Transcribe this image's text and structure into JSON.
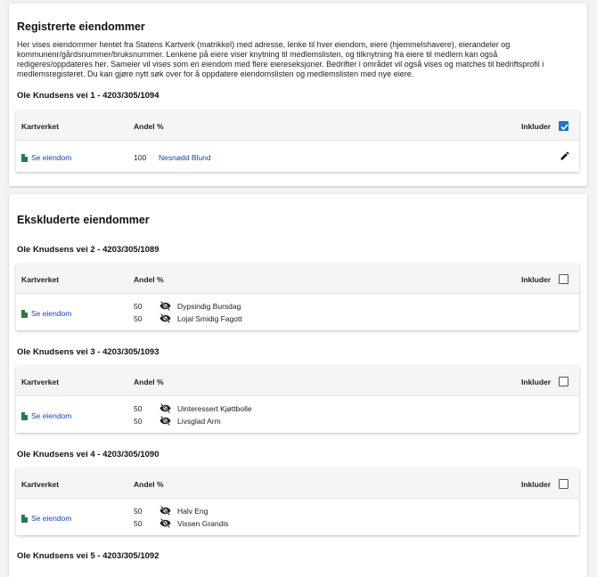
{
  "registered": {
    "title": "Registrerte eiendommer",
    "description": "Her vises eiendommer hentet fra Statens Kartverk (matrikkel) med adresse, lenke til hver eiendom, eiere (hjemmelshavere), eierandeler og kommunenr/gårdsnummer/bruksnummer. Lenkene på eiere viser knytning til medlemslisten, og tilknytning fra eiere til medlem kan også redigeres/oppdateres her. Sameier vil vises som en eiendom med flere eiereseksjoner. Bedrifter i området vil også vises og matches til bedriftsprofil i medlemsregisteret. Du kan gjøre nytt søk over for å oppdatere eiendomslisten og medlemslisten med nye eiere.",
    "properties": [
      {
        "address": "Ole Knudsens vei 1 - 4203/305/1094",
        "col_source": "Kartverket",
        "col_share": "Andel %",
        "col_include": "Inkluder",
        "included": true,
        "link_label": "Se eiendom",
        "owners": [
          {
            "share": "100",
            "name": "Nesnødd Blund"
          }
        ]
      }
    ]
  },
  "excluded": {
    "title": "Ekskluderte eiendommer",
    "properties": [
      {
        "address": "Ole Knudsens vei 2 - 4203/305/1089",
        "col_source": "Kartverket",
        "col_share": "Andel %",
        "col_include": "Inkluder",
        "included": false,
        "link_label": "Se eiendom",
        "owners": [
          {
            "share": "50",
            "name": "Dypsindig Bursdag"
          },
          {
            "share": "50",
            "name": "Lojal Smidig Fagott"
          }
        ]
      },
      {
        "address": "Ole Knudsens vei 3 - 4203/305/1093",
        "col_source": "Kartverket",
        "col_share": "Andel %",
        "col_include": "Inkluder",
        "included": false,
        "link_label": "Se eiendom",
        "owners": [
          {
            "share": "50",
            "name": "Uinteressert Kjøttbolle"
          },
          {
            "share": "50",
            "name": "Livsglad Arm"
          }
        ]
      },
      {
        "address": "Ole Knudsens vei 4 - 4203/305/1090",
        "col_source": "Kartverket",
        "col_share": "Andel %",
        "col_include": "Inkluder",
        "included": false,
        "link_label": "Se eiendom",
        "owners": [
          {
            "share": "50",
            "name": "Halv Eng"
          },
          {
            "share": "50",
            "name": "Vissen Grandis"
          }
        ]
      },
      {
        "address": "Ole Knudsens vei 5 - 4203/305/1092"
      }
    ]
  },
  "colors": {
    "link": "#1a3ec9",
    "checkbox": "#1976d2",
    "header_bg": "#f5f5f5"
  },
  "icons": {
    "kartverket": "kartverket-logo-icon",
    "hidden_owner": "eye-off-icon",
    "edit": "pencil-icon"
  }
}
